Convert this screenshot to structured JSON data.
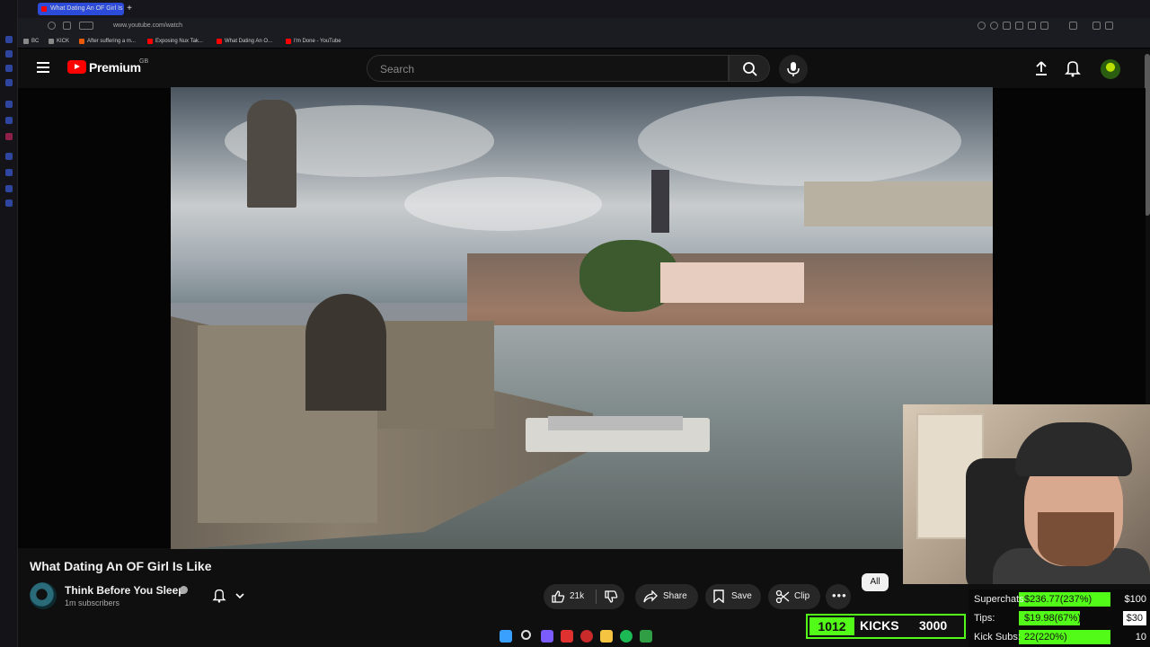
{
  "browser": {
    "tabs": [
      {
        "title": "What Dating An OF Girl Is",
        "active": true
      }
    ],
    "url": "www.youtube.com/watch",
    "bookmarks": [
      "BC",
      "KICK",
      "After suffering a m...",
      "Exposing Nux Tak...",
      "What Dating An O...",
      "I'm Done - YouTube"
    ]
  },
  "youtube": {
    "logo_text": "Premium",
    "region": "GB",
    "search_placeholder": "Search",
    "icons": {
      "menu": "hamburger-menu-icon",
      "search": "search-icon",
      "mic": "microphone-icon",
      "upload": "upload-icon",
      "notifications": "bell-icon"
    }
  },
  "video": {
    "title": "What Dating An OF Girl Is Like",
    "channel": "Think Before You Sleep",
    "subscribers": "1m subscribers",
    "likes": "21k",
    "actions": {
      "share": "Share",
      "save": "Save",
      "clip": "Clip"
    },
    "chip_all": "All"
  },
  "overlay": {
    "kicks_count": "1012",
    "kicks_label": "KICKS",
    "kicks_goal": "3000",
    "goals": [
      {
        "label": "Superchats:",
        "value": "$236.77(237%)",
        "target": "$100",
        "fill": 1.0
      },
      {
        "label": "Tips:",
        "value": "$19.98(67%)",
        "target": "$30",
        "fill": 0.67
      },
      {
        "label": "Kick Subs:",
        "value": "22(220%)",
        "target": "10",
        "fill": 1.0
      }
    ]
  },
  "colors": {
    "background": "#0f0f0f",
    "youtube_red": "#ff0000",
    "kick_green": "#53fc18",
    "pill_bg": "#272727",
    "browser_tab_active": "#2b4bd8"
  }
}
